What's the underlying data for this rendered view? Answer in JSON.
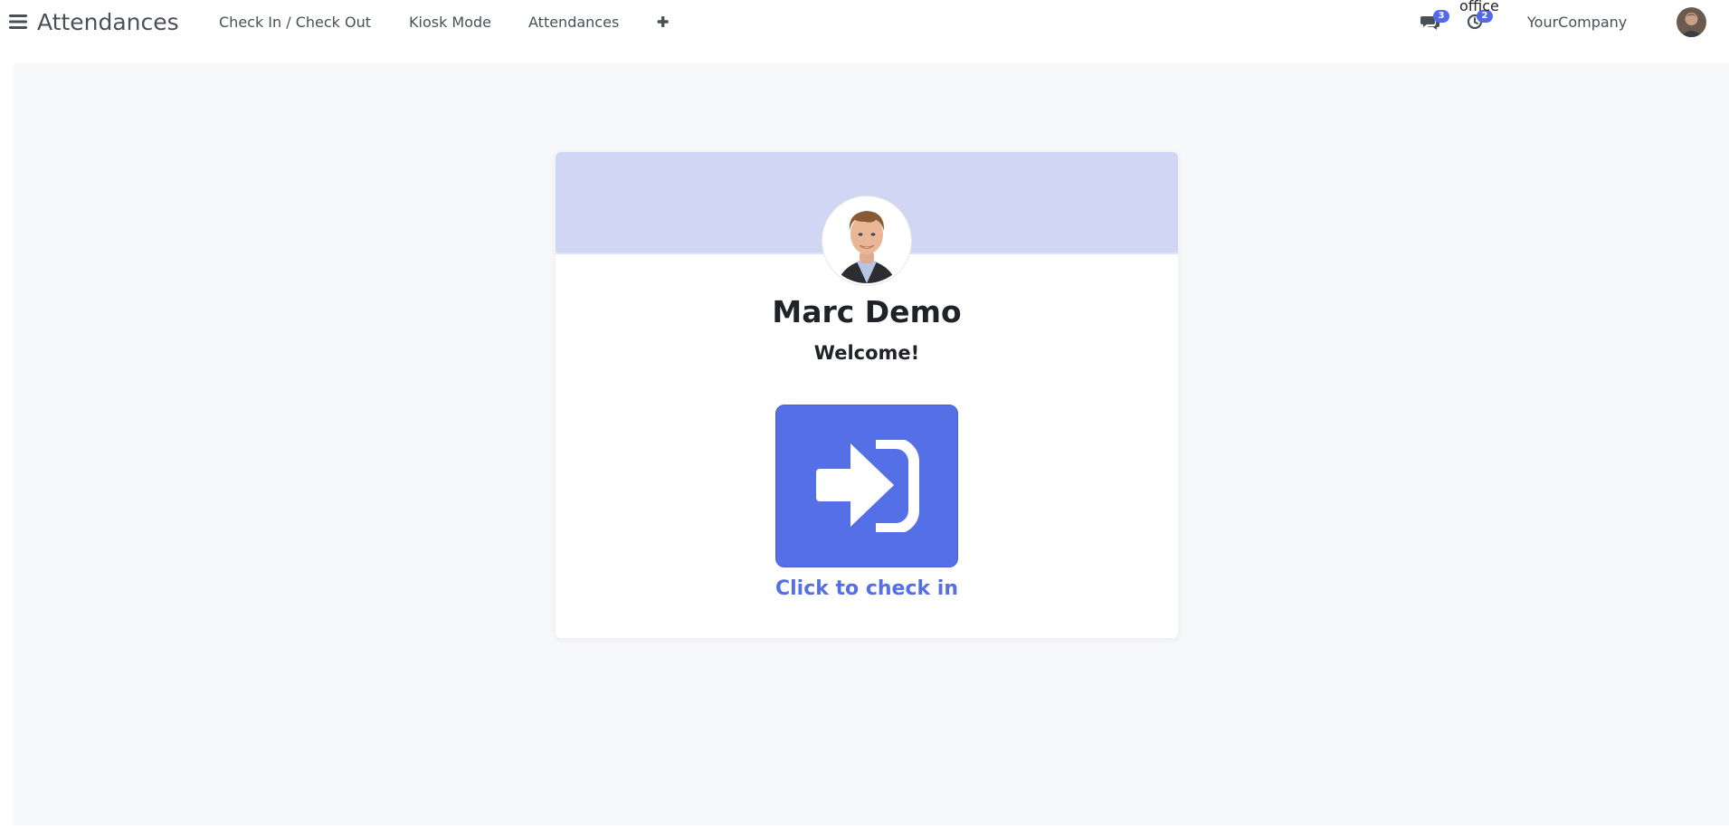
{
  "app": {
    "title": "Attendances"
  },
  "nav": {
    "items": [
      {
        "label": "Check In / Check Out"
      },
      {
        "label": "Kiosk Mode"
      },
      {
        "label": "Attendances"
      }
    ],
    "plus_icon": "plus-icon"
  },
  "systray": {
    "messages_icon": "chat-icon",
    "messages_count": "3",
    "activities_icon": "clock-icon",
    "activities_count": "2",
    "tooltip": "office",
    "company": "YourCompany",
    "user_avatar": "user-avatar"
  },
  "employee": {
    "name": "Marc Demo",
    "greeting": "Welcome!",
    "avatar": "employee-avatar"
  },
  "checkin": {
    "icon": "sign-in-icon",
    "label": "Click to check in",
    "color": "#5570e6"
  },
  "colors": {
    "header_band": "#d1d6f4",
    "badge": "#5469e6",
    "background": "#f7f8fa"
  }
}
